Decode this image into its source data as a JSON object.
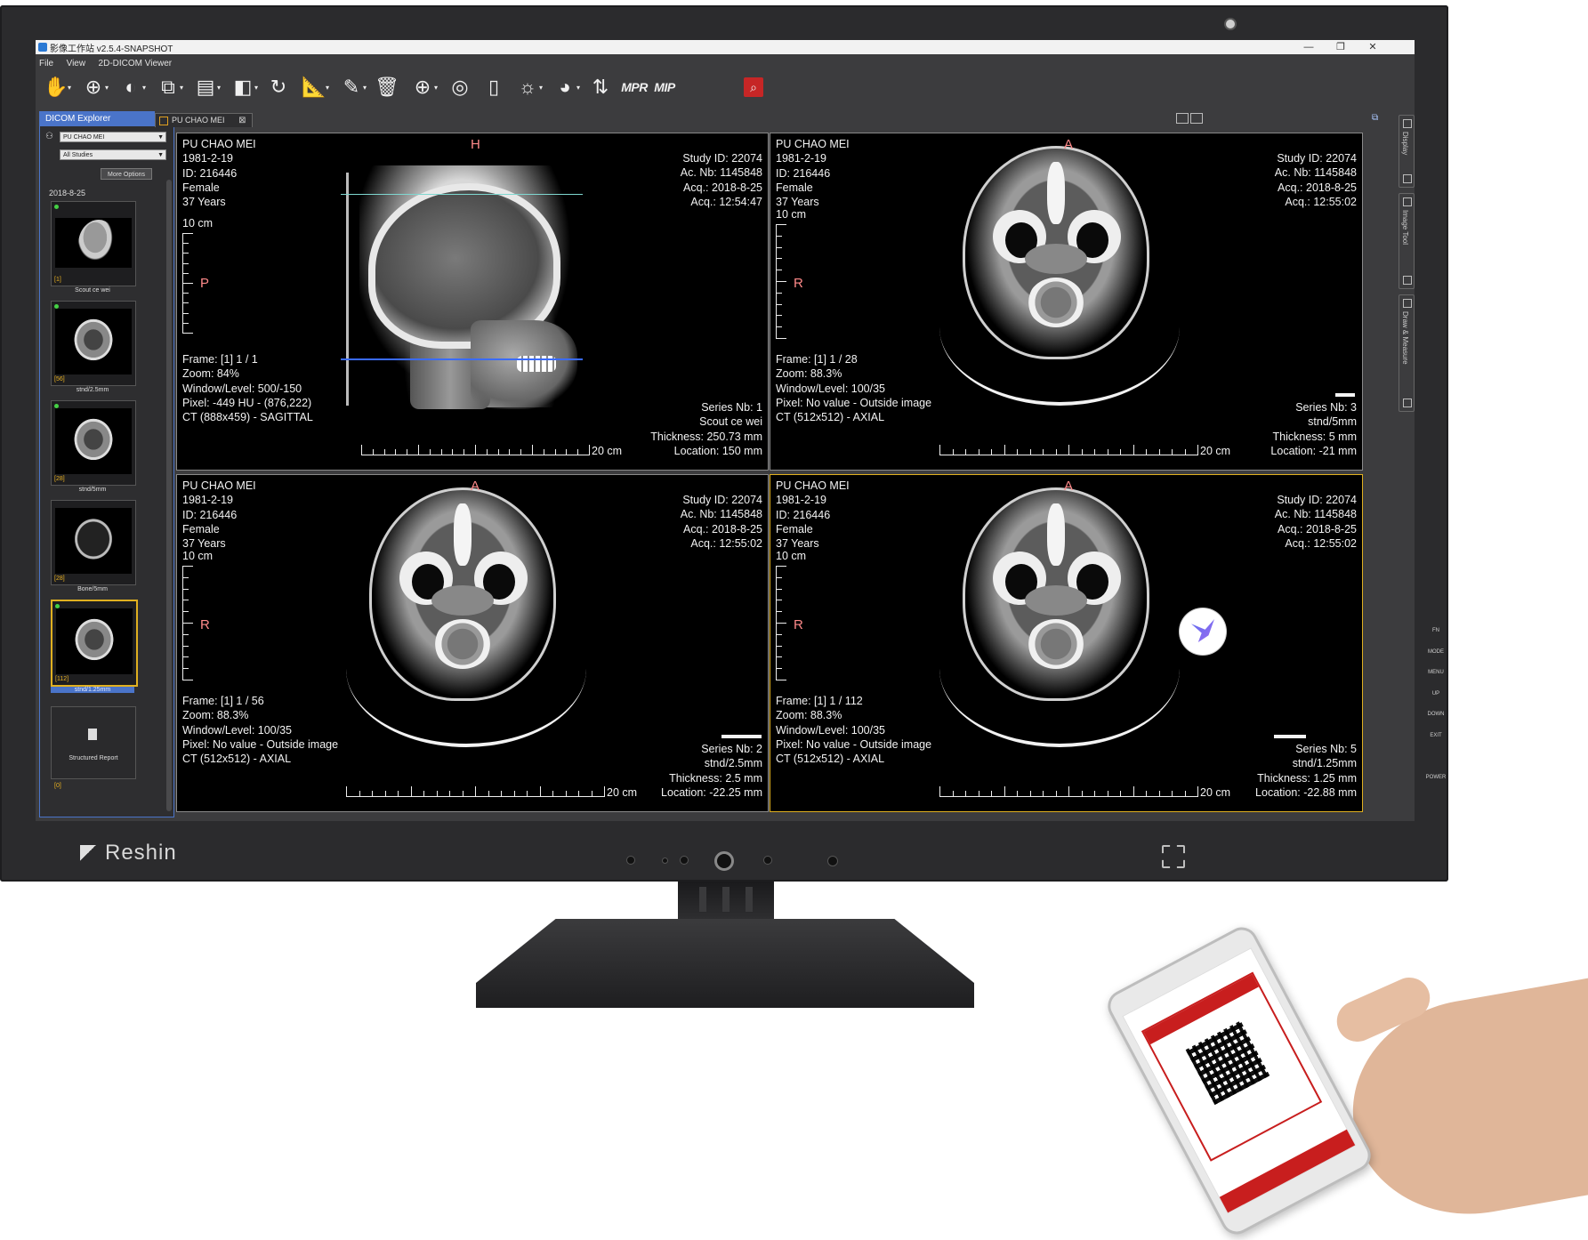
{
  "window": {
    "title": "影像工作站 v2.5.4-SNAPSHOT",
    "controls": [
      "—",
      "❐",
      "✕"
    ]
  },
  "menu": [
    "File",
    "View",
    "2D-DICOM Viewer"
  ],
  "toolbar": {
    "icons": [
      "hand-layout-icon",
      "crosshair-icon",
      "window-level-icon",
      "stack-icon",
      "grid-layout-icon",
      "flip-icon",
      "rotate-icon",
      "ruler-icon",
      "annotate-icon",
      "trash-icon",
      "zoom-icon",
      "fit-icon",
      "document-icon",
      "brightness-icon",
      "color-map-icon",
      "sort-icon"
    ],
    "mpr_label": "MPR",
    "mip_label": "MIP",
    "search_icon": "search-icon"
  },
  "explorer": {
    "title": "DICOM Explorer",
    "patient": "PU CHAO MEI",
    "studies": "All Studies",
    "more_options": "More Options",
    "date": "2018-8-25",
    "thumbnails": [
      {
        "num": "[1]",
        "caption": "Scout ce wei"
      },
      {
        "num": "[56]",
        "caption": "stnd/2.5mm"
      },
      {
        "num": "[28]",
        "caption": "stnd/5mm"
      },
      {
        "num": "[28]",
        "caption": "Bone/5mm"
      },
      {
        "num": "[112]",
        "caption": "stnd/1.25mm"
      },
      {
        "num": "[0]",
        "caption": "Structured Report"
      }
    ]
  },
  "tab": {
    "label": "PU CHAO MEI"
  },
  "dock": {
    "sections": [
      "Display",
      "Image Tool",
      "Draw & Measure"
    ]
  },
  "viewports": [
    {
      "patient": "PU CHAO MEI",
      "dob": "1981-2-19",
      "id": "ID: 216446",
      "sex": "Female",
      "age": "37 Years",
      "study_id": "Study ID: 22074",
      "acc": "Ac. Nb: 1145848",
      "acq_date": "Acq.: 2018-8-25",
      "acq_time": "Acq.: 12:54:47",
      "top_orient": "H",
      "left_orient": "P",
      "vscale": "10 cm",
      "hscale": "20 cm",
      "frame": "Frame: [1] 1 / 1",
      "zoom": "Zoom: 84%",
      "wl": "Window/Level: 500/-150",
      "pixel": "Pixel: -449 HU - (876,222)",
      "ct": "CT (888x459) - SAGITTAL",
      "series_nb": "Series Nb: 1",
      "series_desc": "Scout ce wei",
      "thickness": "Thickness: 250.73 mm",
      "location": "Location: 150 mm"
    },
    {
      "patient": "PU CHAO MEI",
      "dob": "1981-2-19",
      "id": "ID: 216446",
      "sex": "Female",
      "age": "37 Years",
      "study_id": "Study ID: 22074",
      "acc": "Ac. Nb: 1145848",
      "acq_date": "Acq.: 2018-8-25",
      "acq_time": "Acq.: 12:55:02",
      "top_orient": "A",
      "left_orient": "R",
      "vscale": "10 cm",
      "hscale": "20 cm",
      "frame": "Frame: [1] 1 / 28",
      "zoom": "Zoom: 88.3%",
      "wl": "Window/Level: 100/35",
      "pixel": "Pixel: No value - Outside image",
      "ct": "CT (512x512) - AXIAL",
      "series_nb": "Series Nb: 3",
      "series_desc": "stnd/5mm",
      "thickness": "Thickness: 5 mm",
      "location": "Location: -21 mm"
    },
    {
      "patient": "PU CHAO MEI",
      "dob": "1981-2-19",
      "id": "ID: 216446",
      "sex": "Female",
      "age": "37 Years",
      "study_id": "Study ID: 22074",
      "acc": "Ac. Nb: 1145848",
      "acq_date": "Acq.: 2018-8-25",
      "acq_time": "Acq.: 12:55:02",
      "top_orient": "A",
      "left_orient": "R",
      "vscale": "10 cm",
      "hscale": "20 cm",
      "frame": "Frame: [1] 1 / 56",
      "zoom": "Zoom: 88.3%",
      "wl": "Window/Level: 100/35",
      "pixel": "Pixel: No value - Outside image",
      "ct": "CT (512x512) - AXIAL",
      "series_nb": "Series Nb: 2",
      "series_desc": "stnd/2.5mm",
      "thickness": "Thickness: 2.5 mm",
      "location": "Location: -22.25 mm"
    },
    {
      "patient": "PU CHAO MEI",
      "dob": "1981-2-19",
      "id": "ID: 216446",
      "sex": "Female",
      "age": "37 Years",
      "study_id": "Study ID: 22074",
      "acc": "Ac. Nb: 1145848",
      "acq_date": "Acq.: 2018-8-25",
      "acq_time": "Acq.: 12:55:02",
      "top_orient": "A",
      "left_orient": "R",
      "vscale": "10 cm",
      "hscale": "20 cm",
      "frame": "Frame: [1] 1 / 112",
      "zoom": "Zoom: 88.3%",
      "wl": "Window/Level: 100/35",
      "pixel": "Pixel: No value - Outside image",
      "ct": "CT (512x512) - AXIAL",
      "series_nb": "Series Nb: 5",
      "series_desc": "stnd/1.25mm",
      "thickness": "Thickness: 1.25 mm",
      "location": "Location: -22.88 mm"
    }
  ],
  "monitor": {
    "brand": "Reshin",
    "side_buttons": [
      "FN",
      "MODE",
      "MENU",
      "UP",
      "DOWN",
      "EXIT",
      "",
      "POWER"
    ]
  },
  "colors": {
    "accent": "#4a74c9",
    "active_border": "#e0b020",
    "orientation": "#ff8a8a",
    "search_button": "#c62626"
  }
}
